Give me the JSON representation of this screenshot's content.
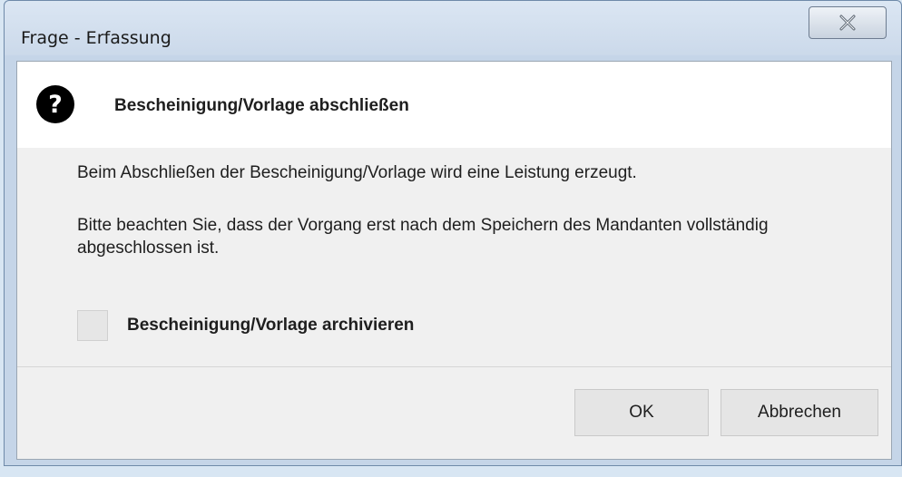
{
  "window": {
    "title": "Frage - Erfassung",
    "close_icon": "close-icon"
  },
  "header": {
    "icon": "question-icon",
    "title": "Bescheinigung/Vorlage abschließen"
  },
  "messages": {
    "line1": "Beim Abschließen der Bescheinigung/Vorlage wird eine Leistung erzeugt.",
    "line2": "Bitte beachten Sie, dass der Vorgang erst nach dem Speichern des Mandanten vollständig abgeschlossen ist."
  },
  "archive_option": {
    "label": "Bescheinigung/Vorlage archivieren",
    "checked": false
  },
  "buttons": {
    "ok": "OK",
    "cancel": "Abbrechen"
  },
  "colors": {
    "header_background": "#ffffff",
    "body_background": "#f0f0f0",
    "titlebar": "#cbd9ea",
    "button_background": "#e5e5e5"
  }
}
